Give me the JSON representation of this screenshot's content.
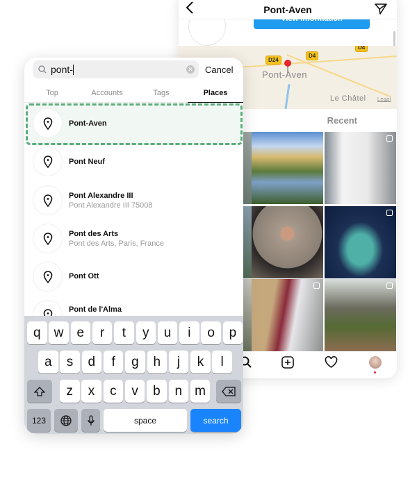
{
  "place_page": {
    "title": "Pont-Aven",
    "view_info_label": "View information",
    "map": {
      "labels": [
        "Pont-Aven",
        "Le Châtel"
      ],
      "roads": [
        "D24",
        "D4",
        "D4"
      ],
      "legal": "Legal"
    },
    "recent_label": "Recent",
    "nav_icons": [
      "search-icon",
      "plus-square-icon",
      "heart-icon",
      "profile-avatar"
    ]
  },
  "search": {
    "query": "pont-",
    "cancel_label": "Cancel",
    "tabs": [
      {
        "label": "Top",
        "active": false
      },
      {
        "label": "Accounts",
        "active": false
      },
      {
        "label": "Tags",
        "active": false
      },
      {
        "label": "Places",
        "active": true
      }
    ],
    "results": [
      {
        "title": "Pont-Aven",
        "subtitle": ""
      },
      {
        "title": "Pont Neuf",
        "subtitle": ""
      },
      {
        "title": "Pont Alexandre III",
        "subtitle": "Pont Alexandre III 75008"
      },
      {
        "title": "Pont des Arts",
        "subtitle": "Pont des Arts, Paris, France"
      },
      {
        "title": "Pont Ott",
        "subtitle": ""
      },
      {
        "title": "Pont de l'Alma",
        "subtitle": ""
      }
    ],
    "highlight_color": "#5aad7a"
  },
  "keyboard": {
    "row1": [
      "q",
      "w",
      "e",
      "r",
      "t",
      "y",
      "u",
      "i",
      "o",
      "p"
    ],
    "row2": [
      "a",
      "s",
      "d",
      "f",
      "g",
      "h",
      "j",
      "k",
      "l"
    ],
    "row3": [
      "z",
      "x",
      "c",
      "v",
      "b",
      "n",
      "m"
    ],
    "numbers_label": "123",
    "space_label": "space",
    "search_label": "search",
    "accent": "#1a84ff"
  }
}
